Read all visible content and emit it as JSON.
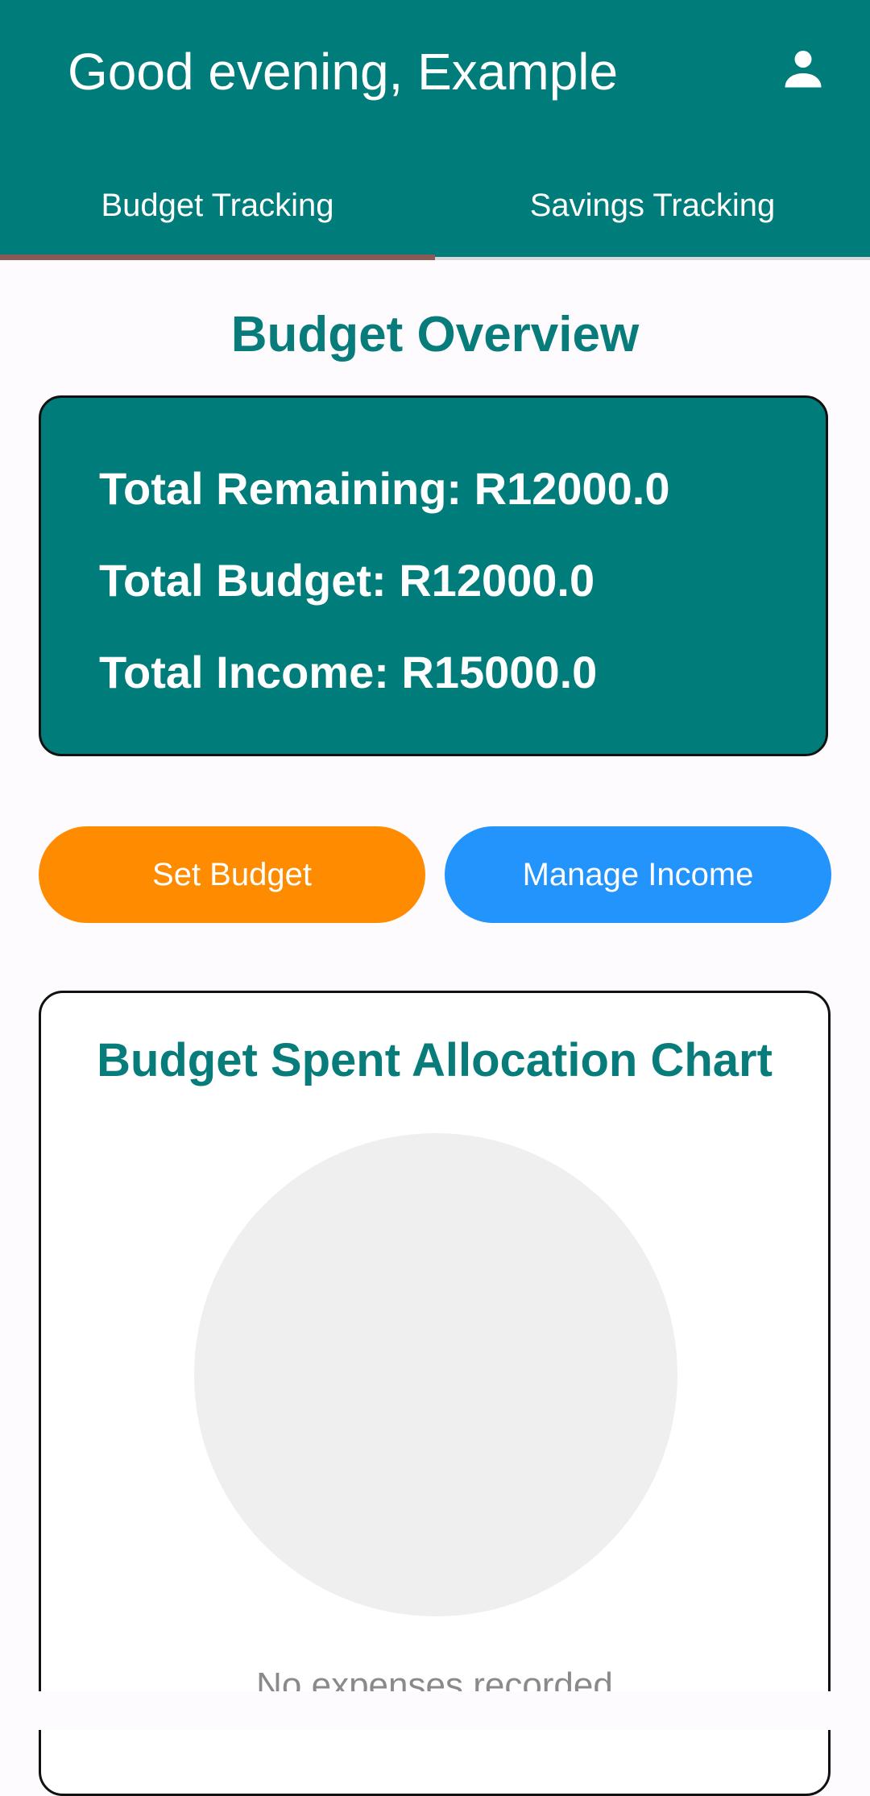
{
  "header": {
    "greeting": "Good evening, Example",
    "profile_icon": "person-icon"
  },
  "tabs": [
    {
      "label": "Budget Tracking",
      "selected": true
    },
    {
      "label": "Savings Tracking",
      "selected": false
    }
  ],
  "overview": {
    "title": "Budget Overview",
    "total_remaining": "Total Remaining: R12000.0",
    "total_budget": "Total Budget: R12000.0",
    "total_income": "Total Income: R15000.0"
  },
  "actions": {
    "set_budget": "Set Budget",
    "manage_income": "Manage Income"
  },
  "chart": {
    "title": "Budget Spent Allocation Chart",
    "empty_message": "No expenses recorded"
  },
  "chart_data": {
    "type": "pie",
    "title": "Budget Spent Allocation Chart",
    "categories": [],
    "values": []
  },
  "colors": {
    "primary": "#007c7b",
    "tab_indicator": "#8b5a57",
    "set_budget_button": "#ff8c00",
    "manage_income_button": "#2394fc",
    "empty_pie": "#efefef"
  }
}
